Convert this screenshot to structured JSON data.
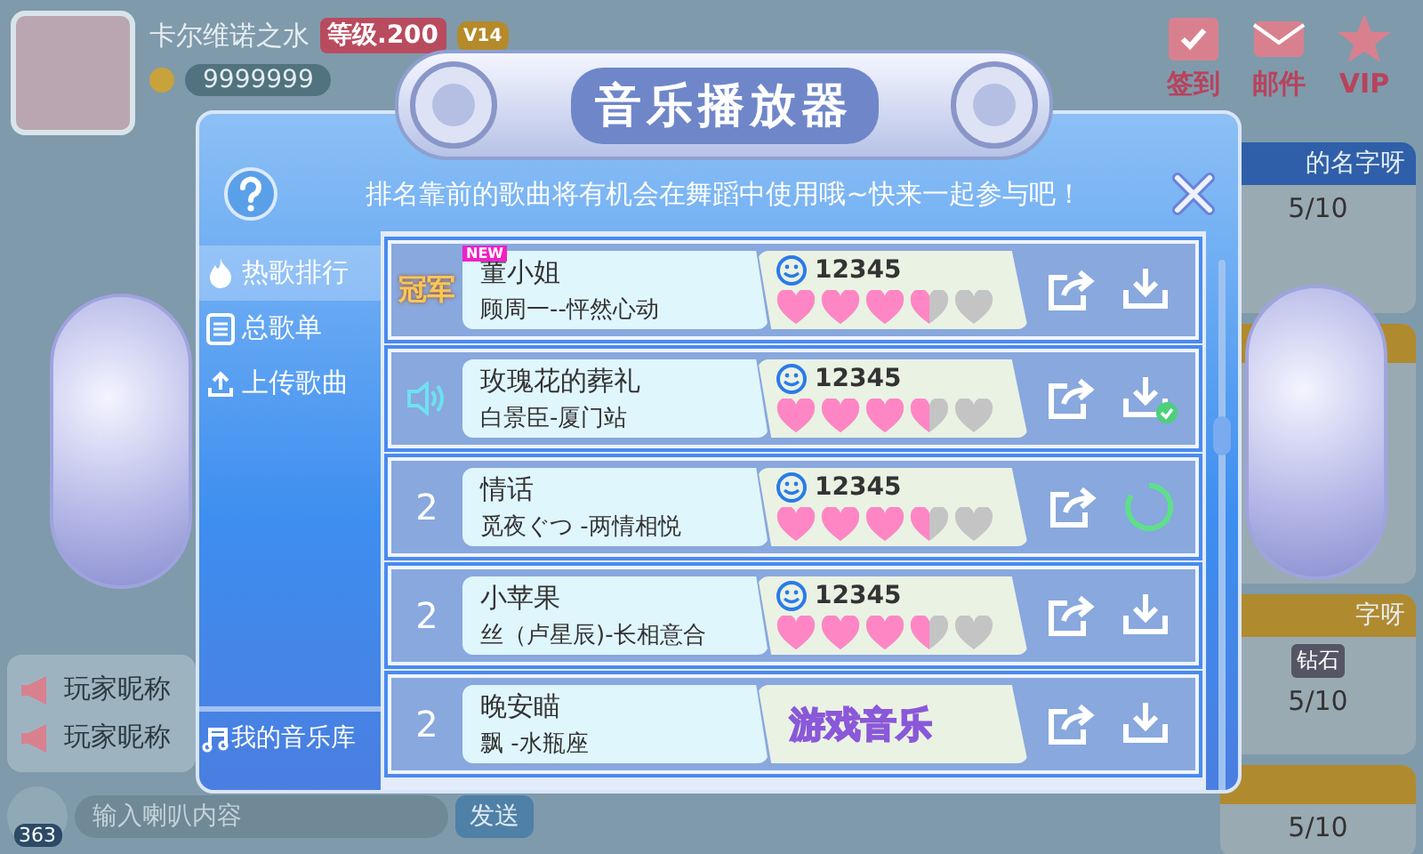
{
  "player": {
    "name": "卡尔维诺之水",
    "level": "等级.200",
    "vip": "V14",
    "gold": "9999999"
  },
  "top_menu": [
    {
      "label": "签到",
      "kind": "calendar"
    },
    {
      "label": "邮件",
      "kind": "mail"
    },
    {
      "label": "VIP",
      "kind": "star"
    }
  ],
  "rooms": [
    {
      "name": "的名字呀",
      "count": "5/10",
      "color": "#2f5fa8"
    },
    {
      "color": "#b08a2e"
    },
    {
      "name": "字呀",
      "badge": "钻石",
      "count": "5/10",
      "color": "#b08a2e"
    },
    {
      "count": "5/10",
      "color": "#b08a2e"
    }
  ],
  "chat": {
    "lines": [
      "玩家昵称",
      "玩家昵称"
    ],
    "horn_count": "363",
    "placeholder": "输入喇叭内容",
    "send": "发送"
  },
  "dialog": {
    "title": "音乐播放器",
    "hint": "排名靠前的歌曲将有机会在舞蹈中使用哦~快来一起参与吧！",
    "menu": [
      {
        "label": "热歌排行",
        "kind": "fire",
        "selected": true
      },
      {
        "label": "总歌单",
        "kind": "list",
        "selected": false
      },
      {
        "label": "上传歌曲",
        "kind": "upload",
        "selected": false
      }
    ],
    "library": {
      "label": "我的音乐库",
      "selected": false
    },
    "songs": [
      {
        "kind": "champion",
        "rank": "冠军",
        "new_tag": "NEW",
        "title": "董小姐",
        "artist": "顾周一--怦然心动",
        "score": "12345",
        "stars": 3.5,
        "downloaded": false,
        "downloading": false
      },
      {
        "kind": "playing",
        "title": "玫瑰花的葬礼",
        "artist": "白景臣-厦门站",
        "score": "12345",
        "stars": 3.5,
        "downloaded": true,
        "downloading": false
      },
      {
        "kind": "number",
        "rank": "2",
        "title": "情话",
        "artist": "觅夜ぐつ -两情相悦",
        "score": "12345",
        "stars": 3.5,
        "downloaded": false,
        "downloading": true
      },
      {
        "kind": "number",
        "rank": "2",
        "title": "小苹果",
        "artist": "丝（卢星辰)-长相意合",
        "score": "12345",
        "stars": 3.5,
        "downloaded": false,
        "downloading": false
      },
      {
        "kind": "number",
        "rank": "2",
        "title": "晚安瞄",
        "artist": "飘 -水瓶座",
        "label": "游戏音乐",
        "downloaded": false,
        "downloading": false
      }
    ]
  }
}
